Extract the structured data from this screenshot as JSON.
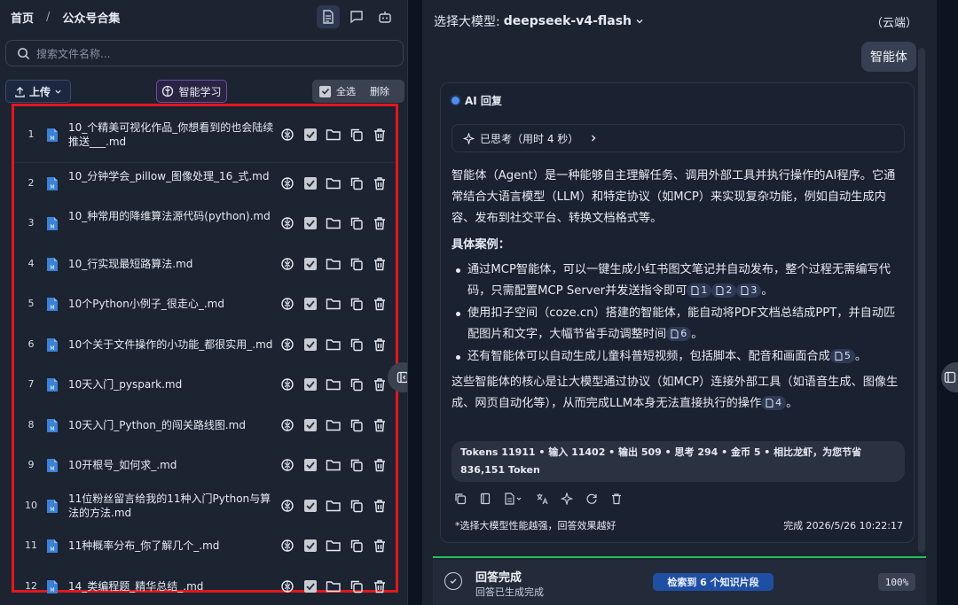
{
  "left": {
    "breadcrumb": {
      "home": "首页",
      "sep": "/",
      "current": "公众号合集"
    },
    "search_placeholder": "搜索文件名称...",
    "upload_label": "上传",
    "smart_learn_label": "智能学习",
    "select_all_label": "全选",
    "delete_label": "删除",
    "files": [
      {
        "num": "1",
        "name": "10_个精美可视化作品_你想看到的也会陆续推送___.md"
      },
      {
        "num": "2",
        "name": "10_分钟学会_pillow_图像处理_16_式.md"
      },
      {
        "num": "3",
        "name": "10_种常用的降维算法源代码(python).md"
      },
      {
        "num": "4",
        "name": "10_行实现最短路算法.md"
      },
      {
        "num": "5",
        "name": "10个Python小例子_很走心_.md"
      },
      {
        "num": "6",
        "name": "10个关于文件操作的小功能_都很实用_.md"
      },
      {
        "num": "7",
        "name": "10天入门_pyspark.md"
      },
      {
        "num": "8",
        "name": "10天入门_Python_的闯关路线图.md"
      },
      {
        "num": "9",
        "name": "10开根号_如何求_.md"
      },
      {
        "num": "10",
        "name": "11位粉丝留言给我的11种入门Python与算法的方法.md"
      },
      {
        "num": "11",
        "name": "11种概率分布_你了解几个_.md"
      },
      {
        "num": "12",
        "name": "14_类编程题_精华总结_.md"
      }
    ]
  },
  "right": {
    "model_prefix": "选择大模型:",
    "model_name": "deepseek-v4-flash",
    "cloud_label": "（云端）",
    "user_message": "智能体",
    "ai_label": "AI 回复",
    "thought_label": "已思考（用时 4 秒）",
    "answer": {
      "intro": "智能体（Agent）是一种能够自主理解任务、调用外部工具并执行操作的AI程序。它通常结合大语言模型（LLM）和特定协议（如MCP）来实现复杂功能，例如自动生成内容、发布到社交平台、转换文档格式等。",
      "cases_title": "具体案例：",
      "case1": "通过MCP智能体，可以一键生成小红书图文笔记并自动发布，整个过程无需编写代码，只需配置MCP Server并发送指令即可",
      "case1_cites": [
        "1",
        "2",
        "3"
      ],
      "case1_end": "。",
      "case2": "使用扣子空间（coze.cn）搭建的智能体，能自动将PDF文档总结成PPT，并自动匹配图片和文字，大幅节省手动调整时间",
      "case2_cites": [
        "6"
      ],
      "case2_end": "。",
      "case3": "还有智能体可以自动生成儿童科普短视频，包括脚本、配音和画面合成",
      "case3_cites": [
        "5"
      ],
      "case3_end": "。",
      "summary": "这些智能体的核心是让大模型通过协议（如MCP）连接外部工具（如语音生成、图像生成、网页自动化等），从而完成LLM本身无法直接执行的操作",
      "summary_cites": [
        "4"
      ],
      "summary_end": "。"
    },
    "tokens_text": "Tokens 11911 • 输入 11402 • 输出 509 • 思考 294 • 金币 5 • 相比龙虾，为您节省 836,151 Token",
    "footer_note": "*选择大模型性能越强，回答效果越好",
    "footer_time": "完成 2026/5/26 10:22:17",
    "done_title": "回答完成",
    "done_sub": "回答已生成完成",
    "retrieved_badge": "检索到 6 个知识片段",
    "progress": "100%"
  },
  "colors": {
    "accent": "#1f4fa3",
    "progress_green": "#20c05a",
    "highlight_border": "#e0181d"
  }
}
